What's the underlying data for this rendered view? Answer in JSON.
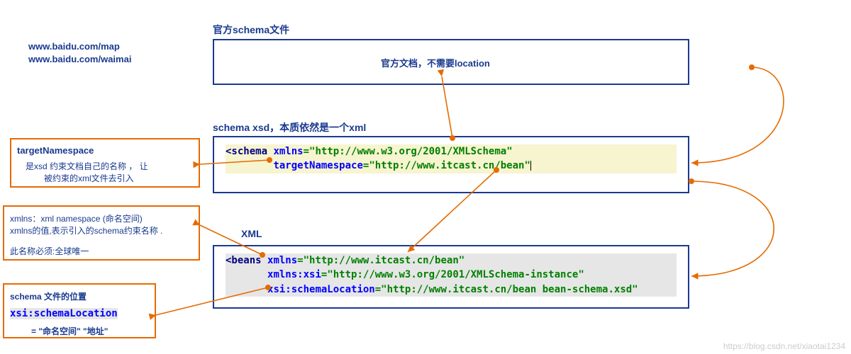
{
  "urls": {
    "baidu_map": "www.baidu.com/map",
    "baidu_waimai": "www.baidu.com/waimai"
  },
  "sections": {
    "official": "官方schema文件",
    "schema_xsd": "schema   xsd，本质依然是一个xml",
    "xml": "XML"
  },
  "official_note": "官方文档，不需要location",
  "code_schema": {
    "tag_open": "<schema",
    "attr_xmlns": "xmlns",
    "val_xmlns": "\"http://www.w3.org/2001/XMLSchema\"",
    "attr_targetns": "targetNamespace",
    "val_targetns": "\"http://www.itcast.cn/bean\""
  },
  "code_xml": {
    "tag_open": "<beans",
    "attr_xmlns": "xmlns",
    "val_xmlns": "\"http://www.itcast.cn/bean\"",
    "attr_xmlns_xsi": "xmlns:xsi",
    "val_xmlns_xsi": "\"http://www.w3.org/2001/XMLSchema-instance\"",
    "attr_schemaloc": "xsi:schemaLocation",
    "val_schemaloc": "\"http://www.itcast.cn/bean bean-schema.xsd\""
  },
  "left_box_targetns": {
    "title": "targetNamespace",
    "desc1": "是xsd 约束文档自己的名称  ， 让",
    "desc2": "被约束的xml文件去引入"
  },
  "left_box_xmlns": {
    "line1": "xmlns：xml namespace (命名空间)",
    "line2": "xmlns的值,表示引入的schema约束名称 .",
    "line3": "此名称必须:全球唯一"
  },
  "left_box_schemaloc": {
    "title": "schema 文件的位置",
    "code": "xsi:schemaLocation",
    "val": "= \"命名空间\" \"地址\""
  },
  "watermark": "https://blog.csdn.net/xiaotai1234"
}
